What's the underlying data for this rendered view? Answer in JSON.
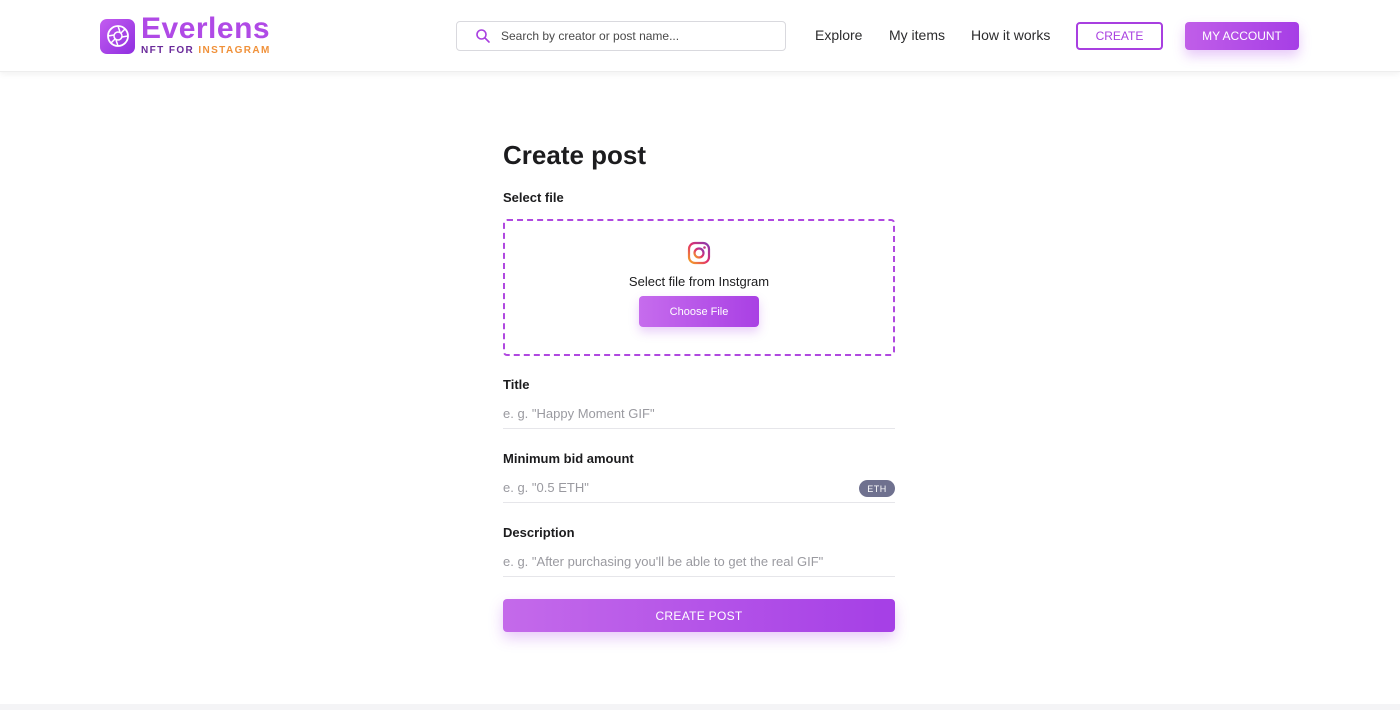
{
  "brand": {
    "name": "Everlens",
    "tagline_prefix": "NFT FOR ",
    "tagline_accent": "INSTAGRAM",
    "icon": "camera-aperture-icon",
    "color": "#b04ae6",
    "accent_color": "#f0913a"
  },
  "search": {
    "placeholder": "Search by creator or post name...",
    "icon": "search-icon"
  },
  "nav": {
    "explore": "Explore",
    "my_items": "My items",
    "how_it_works": "How it works",
    "create": "CREATE",
    "my_account": "MY ACCOUNT"
  },
  "form": {
    "title": "Create post",
    "select_file_label": "Select file",
    "dropzone_text": "Select file from Instgram",
    "dropzone_icon": "instagram-icon",
    "choose_file": "Choose File",
    "title_label": "Title",
    "title_placeholder": "e. g. \"Happy Moment GIF\"",
    "bid_label": "Minimum bid amount",
    "bid_placeholder": "e. g. \"0.5 ETH\"",
    "bid_unit": "ETH",
    "description_label": "Description",
    "description_placeholder": "e. g. \"After purchasing you'll be able to get the real GIF\"",
    "submit": "CREATE POST"
  },
  "colors": {
    "primary": "#a83fe0",
    "badge": "#6f718f"
  }
}
